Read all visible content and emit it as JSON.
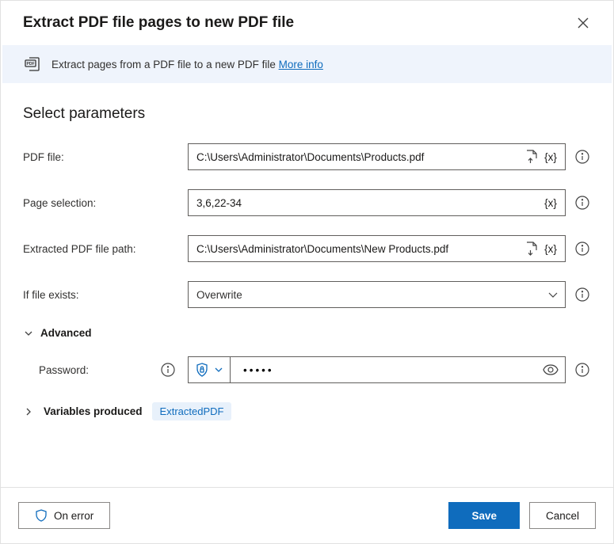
{
  "dialog": {
    "title": "Extract PDF file pages to new PDF file"
  },
  "banner": {
    "text": "Extract pages from a PDF file to a new PDF file ",
    "link": "More info"
  },
  "section": {
    "title": "Select parameters"
  },
  "fields": {
    "pdf_file": {
      "label": "PDF file:",
      "value": "C:\\Users\\Administrator\\Documents\\Products.pdf"
    },
    "page_selection": {
      "label": "Page selection:",
      "value": "3,6,22-34"
    },
    "extracted_path": {
      "label": "Extracted PDF file path:",
      "value": "C:\\Users\\Administrator\\Documents\\New Products.pdf"
    },
    "if_exists": {
      "label": "If file exists:",
      "value": "Overwrite"
    },
    "advanced": {
      "label": "Advanced"
    },
    "password": {
      "label": "Password:",
      "value": "•••••"
    }
  },
  "tokens": {
    "var": "{x}"
  },
  "variables_produced": {
    "label": "Variables produced",
    "chip": "ExtractedPDF"
  },
  "footer": {
    "on_error": "On error",
    "save": "Save",
    "cancel": "Cancel"
  }
}
